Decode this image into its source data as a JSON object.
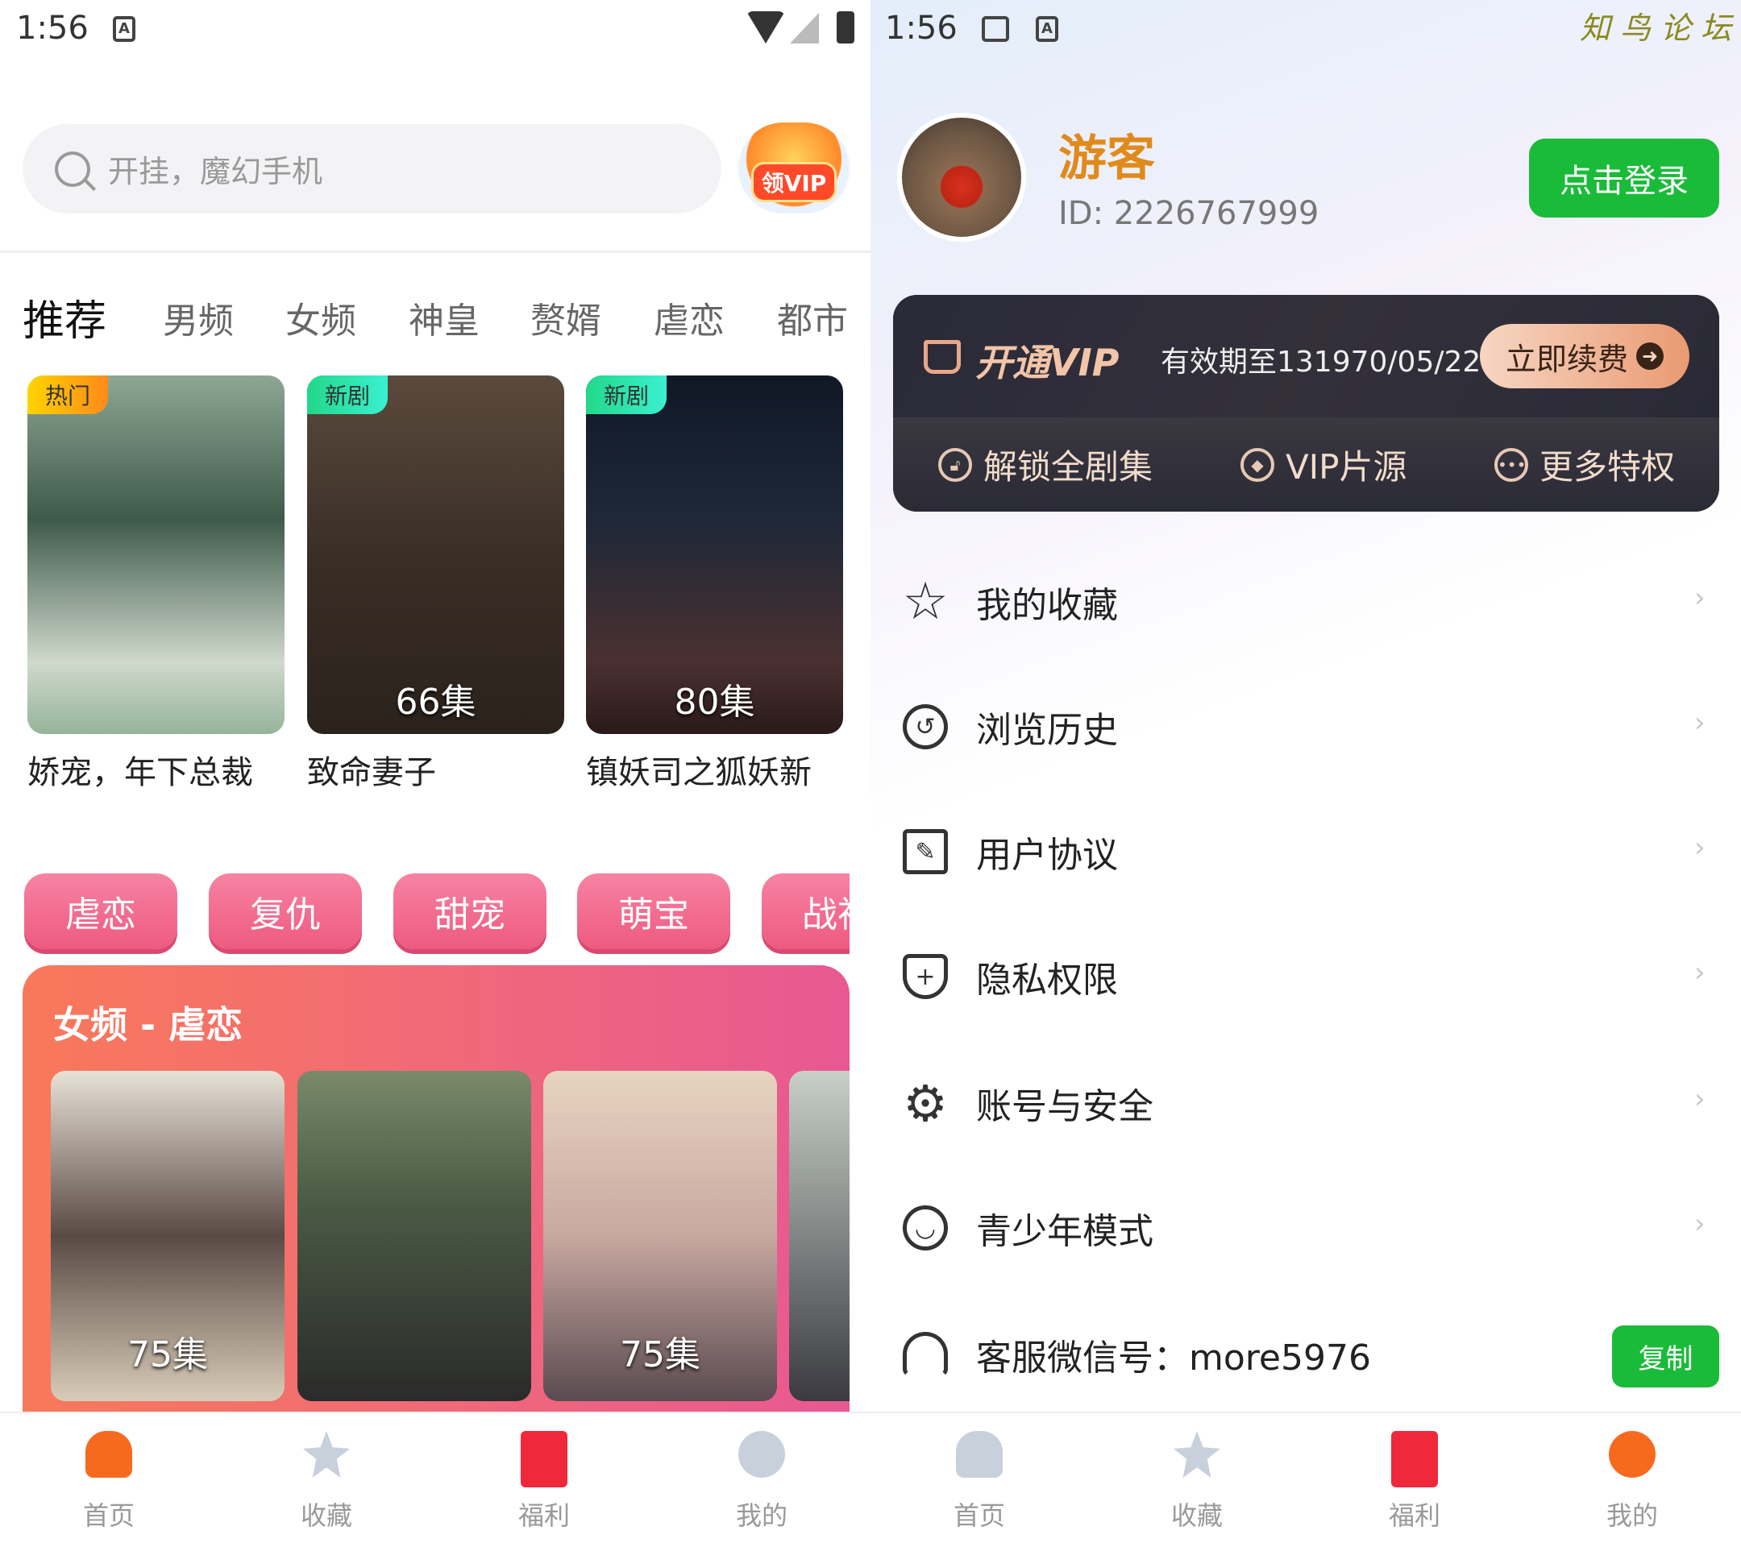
{
  "left": {
    "status": {
      "time": "1:56"
    },
    "search": {
      "placeholder": "开挂，魔幻手机"
    },
    "vip_badge": "领VIP",
    "tabs": [
      "推荐",
      "男频",
      "女频",
      "神皇",
      "赘婿",
      "虐恋",
      "都市"
    ],
    "featured": [
      {
        "badge": "热门",
        "title": "娇宠，年下总裁",
        "episodes": ""
      },
      {
        "badge": "新剧",
        "title": "致命妻子",
        "episodes": "66集"
      },
      {
        "badge": "新剧",
        "title": "镇妖司之狐妖新",
        "episodes": "80集"
      }
    ],
    "chips": [
      "虐恋",
      "复仇",
      "甜宠",
      "萌宝",
      "战神"
    ],
    "section": {
      "title": "女频 - 虐恋",
      "posters": [
        {
          "episodes": "75集"
        },
        {
          "episodes": ""
        },
        {
          "episodes": "75集"
        },
        {
          "episodes": ""
        }
      ]
    },
    "nav": [
      "首页",
      "收藏",
      "福利",
      "我的"
    ],
    "nav_active": 0
  },
  "right": {
    "status": {
      "time": "1:56"
    },
    "watermark": "知鸟论坛",
    "user": {
      "name": "游客",
      "id": "ID: 2226767999"
    },
    "login_label": "点击登录",
    "vip": {
      "title": "开通VIP",
      "expiry": "有效期至131970/05/22",
      "renew": "立即续费",
      "perks": [
        "解锁全剧集",
        "VIP片源",
        "更多特权"
      ]
    },
    "menu": [
      "我的收藏",
      "浏览历史",
      "用户协议",
      "隐私权限",
      "账号与安全",
      "青少年模式",
      "客服微信号：more5976"
    ],
    "copy_label": "复制",
    "nav": [
      "首页",
      "收藏",
      "福利",
      "我的"
    ],
    "nav_active": 3
  },
  "colors": {
    "accent_green": "#1bbb3a",
    "accent_orange": "#f76a1e",
    "vip_dark": "#262633",
    "chip_pink": "#ee5a80"
  }
}
